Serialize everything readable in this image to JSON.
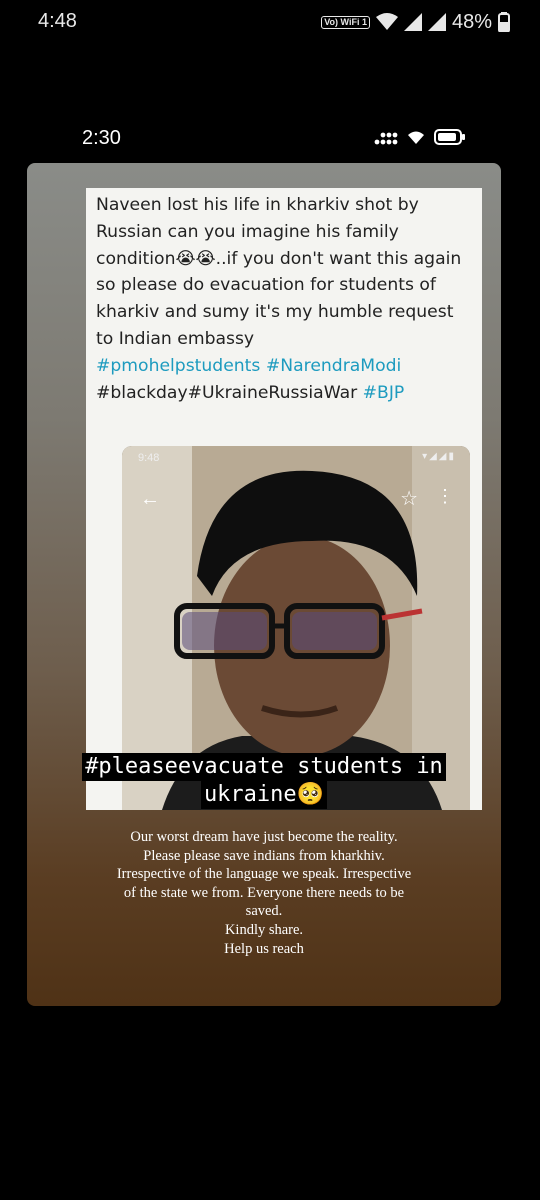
{
  "status_bar": {
    "time": "4:48",
    "volte_label": "Vo) WiFi 1",
    "battery": "48%"
  },
  "story_status": {
    "time": "2:30"
  },
  "post": {
    "text_plain": "Naveen lost his life in kharkiv shot by Russian can you imagine his family condition😭😭..if you don't want this again so please do evacuation for students of kharkiv  and sumy it's my humble request to Indian embassy",
    "hashtags_line1": "#pmohelpstudents #NarendraModi",
    "hashtags_line2_plain": "#blackday#UkraineRussiaWar",
    "hashtags_line2_tag": "#BJP",
    "photo_time": "9:48"
  },
  "overlay": {
    "line1": "#pleaseevacuate students in",
    "line2": "ukraine🥺"
  },
  "caption": {
    "text": "Our worst dream have just become the reality.\nPlease please save indians from kharkhiv. Irrespective of the language we speak. Irrespective of the state we from. Everyone there needs to be saved.\nKindly share.\nHelp us reach"
  }
}
